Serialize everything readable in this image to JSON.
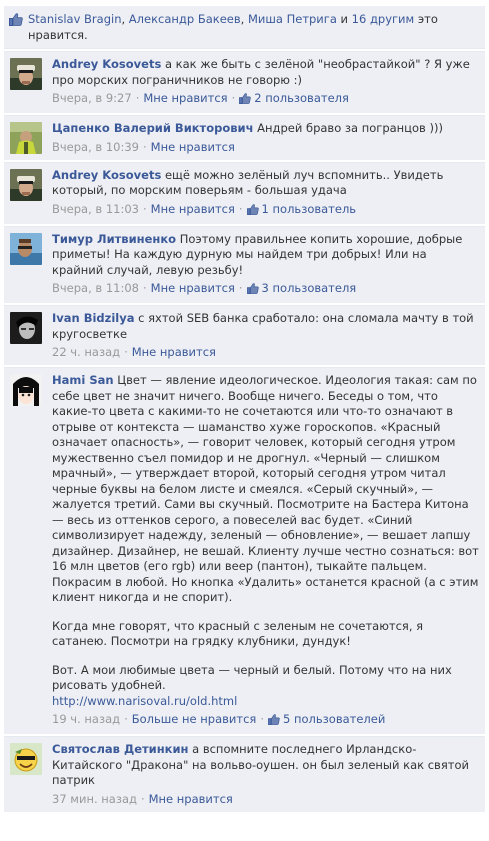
{
  "likes": {
    "names": [
      "Stanislav Bragin",
      "Александр Бакеев",
      "Миша Петрига"
    ],
    "and_text": "и",
    "others_link": "16 другим",
    "suffix": "это нравится."
  },
  "comments": [
    {
      "author": "Andrey Kosovets",
      "text": "а как же быть с зелёной \"необрастайкой\" ? Я уже про морских пограничников не говорю :)",
      "time": "Вчера, в 9:27",
      "like_label": "Мне нравится",
      "likes_count": "2 пользователя",
      "avatar": "avatar-captain"
    },
    {
      "author": "Цапенко Валерий Викторович",
      "text": "Андрей браво за погранцов )))",
      "time": "Вчера, в 10:39",
      "like_label": "Мне нравится",
      "avatar": "avatar-green"
    },
    {
      "author": "Andrey Kosovets",
      "text": "ещё можно зелёный луч вспомнить.. Увидеть который, по морским поверьям - большая удача",
      "time": "Вчера, в 11:03",
      "like_label": "Мне нравится",
      "likes_count": "1 пользователь",
      "avatar": "avatar-captain"
    },
    {
      "author": "Тимур Литвиненко",
      "text": "Поэтому правильнее копить хорошие, добрые приметы! На каждую дурную мы найдем три добрых! Или на крайний случай, левую резьбу!",
      "time": "Вчера, в 11:08",
      "like_label": "Мне нравится",
      "likes_count": "3 пользователя",
      "avatar": "avatar-sea"
    },
    {
      "author": "Ivan Bidzilya",
      "text": "с яхтой SEB банка сработало: она сломала мачту в той кругосветке",
      "time": "22 ч. назад",
      "like_label": "Мне нравится",
      "avatar": "avatar-bw"
    },
    {
      "author": "Hami San",
      "text": "Цвет — явление идеологическое. Идеология такая: сам по себе цвет не значит ничего. Вообще ничего. Беседы о том, что какие-то цвета с какими-то не сочетаются или что-то означают в отрыве от контекста — шаманство хуже гороскопов. «Красный означает опасность», — говорит человек, который сегодня утром мужественно съел помидор и не дрогнул. «Черный — слишком мрачный», — утверждает второй, который сегодня утром читал черные буквы на белом листе и смеялся. «Серый скучный», — жалуется третий. Сами вы скучный. Посмотрите на Бастера Китона — весь из оттенков серого, а повеселей вас будет. «Синий символизирует надежду, зеленый — обновление», — вешает лапшу дизайнер. Дизайнер, не вешай. Клиенту лучше честно сознаться: вот 16 млн цветов (его rgb) или веер (пантон), тыкайте пальцем. Покрасим в любой. Но кнопка «Удалить» останется красной (а с этим клиент никогда и не спорит).",
      "text2": "Когда мне говорят, что красный с зеленым не сочетаются, я сатанею. Посмотри на грядку клубники, дундук!",
      "text3": "Вот. А мои любимые цвета — черный и белый. Потому что на них рисовать удобней.",
      "url": "http://www.narisoval.ru/old.html",
      "time": "19 ч. назад",
      "like_label": "Больше не нравится",
      "likes_count": "5 пользователей",
      "avatar": "avatar-anime"
    },
    {
      "author": "Святослав Детинкин",
      "text": "а вспомните последнего Ирландско-Китайского \"Дракона\" на вольво-оушен. он был зеленый как святой патрик",
      "time": "37 мин. назад",
      "like_label": "Мне нравится",
      "avatar": "avatar-smile"
    }
  ],
  "separator": "·"
}
